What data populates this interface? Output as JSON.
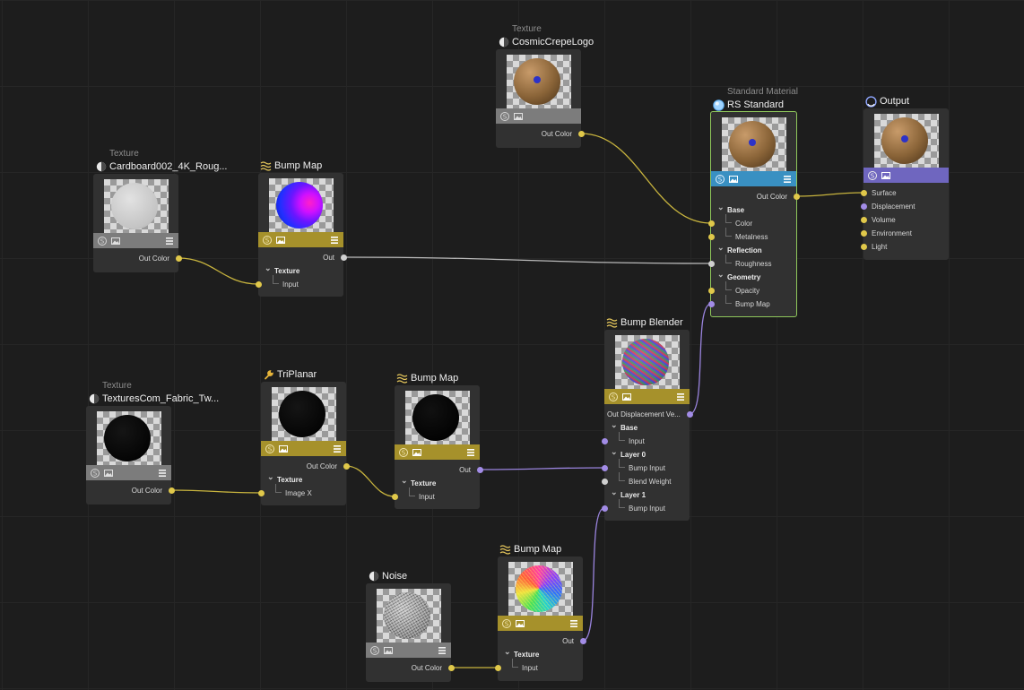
{
  "colors": {
    "wire_yellow": "#c8b43e",
    "wire_purple": "#9a84de",
    "wire_white": "#b8b8b8",
    "bar_gold": "#a6912b",
    "bar_blue": "#3990c2",
    "bar_purple": "#6f66bf",
    "selected_border": "#8fc75b"
  },
  "nodes": {
    "cosmic": {
      "category": "Texture",
      "title": "CosmicCrepeLogo",
      "icon": "texture-icon",
      "output": "Out Color"
    },
    "rs": {
      "category": "Standard Material",
      "title": "RS Standard",
      "icon": "material-icon",
      "output": "Out Color",
      "rows": {
        "base": "Base",
        "color": "Color",
        "metalness": "Metalness",
        "reflection": "Reflection",
        "roughness": "Roughness",
        "geometry": "Geometry",
        "opacity": "Opacity",
        "bump_map": "Bump Map"
      }
    },
    "output": {
      "title": "Output",
      "icon": "output-icon",
      "inputs": {
        "surface": "Surface",
        "displacement": "Displacement",
        "volume": "Volume",
        "environment": "Environment",
        "light": "Light"
      }
    },
    "cardboard": {
      "category": "Texture",
      "title": "Cardboard002_4K_Roug...",
      "icon": "texture-icon",
      "output": "Out Color"
    },
    "bump1": {
      "title": "Bump Map",
      "icon": "bump-map-icon",
      "output": "Out",
      "group": "Texture",
      "input": "Input"
    },
    "fabric": {
      "category": "Texture",
      "title": "TexturesCom_Fabric_Tw...",
      "icon": "texture-icon",
      "output": "Out Color"
    },
    "triplanar": {
      "title": "TriPlanar",
      "icon": "wrench-icon",
      "output": "Out Color",
      "group": "Texture",
      "input": "Image X"
    },
    "bump2": {
      "title": "Bump Map",
      "icon": "bump-map-icon",
      "output": "Out",
      "group": "Texture",
      "input": "Input"
    },
    "blender": {
      "title": "Bump Blender",
      "icon": "bump-map-icon",
      "output": "Out Displacement Ve...",
      "rows": {
        "base": "Base",
        "input": "Input",
        "layer0": "Layer 0",
        "bump_input0": "Bump Input",
        "blend_weight": "Blend Weight",
        "layer1": "Layer 1",
        "bump_input1": "Bump Input"
      }
    },
    "noise": {
      "title": "Noise",
      "icon": "texture-icon",
      "output": "Out Color"
    },
    "bump3": {
      "title": "Bump Map",
      "icon": "bump-map-icon",
      "output": "Out",
      "group": "Texture",
      "input": "Input"
    }
  }
}
